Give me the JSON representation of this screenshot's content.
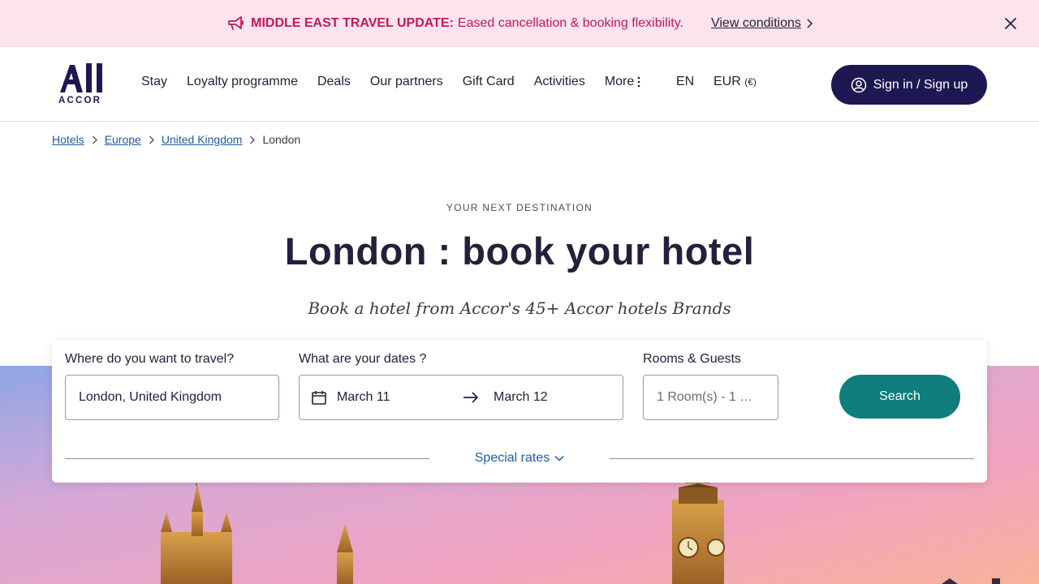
{
  "banner": {
    "strong": "MIDDLE EAST TRAVEL UPDATE:",
    "text": "Eased cancellation & booking flexibility.",
    "link": "View conditions"
  },
  "header": {
    "logo_text": "ACCOR",
    "nav": [
      "Stay",
      "Loyalty programme",
      "Deals",
      "Our partners",
      "Gift Card",
      "Activities",
      "More"
    ],
    "language": "EN",
    "currency": "EUR",
    "currency_symbol": "(€)",
    "signin": "Sign in / Sign up"
  },
  "breadcrumb": {
    "items": [
      "Hotels",
      "Europe",
      "United Kingdom"
    ],
    "current": "London"
  },
  "hero": {
    "eyebrow": "YOUR NEXT DESTINATION",
    "title": "London : book your hotel",
    "subtitle": "Book a hotel from Accor's 45+ Accor hotels Brands"
  },
  "search": {
    "destination_label": "Where do you want to travel?",
    "destination_value": "London, United Kingdom",
    "dates_label": "What are your dates ?",
    "checkin": "March 11",
    "checkout": "March 12",
    "rooms_label": "Rooms & Guests",
    "rooms_value": "1 Room(s) - 1 …",
    "search_button": "Search",
    "special_rates": "Special rates"
  },
  "colors": {
    "brand_navy": "#1e1852",
    "alert_pink": "#c2185b",
    "banner_bg": "#fde4ec",
    "search_teal": "#0f7d7b",
    "link_blue": "#1c5ea5"
  }
}
